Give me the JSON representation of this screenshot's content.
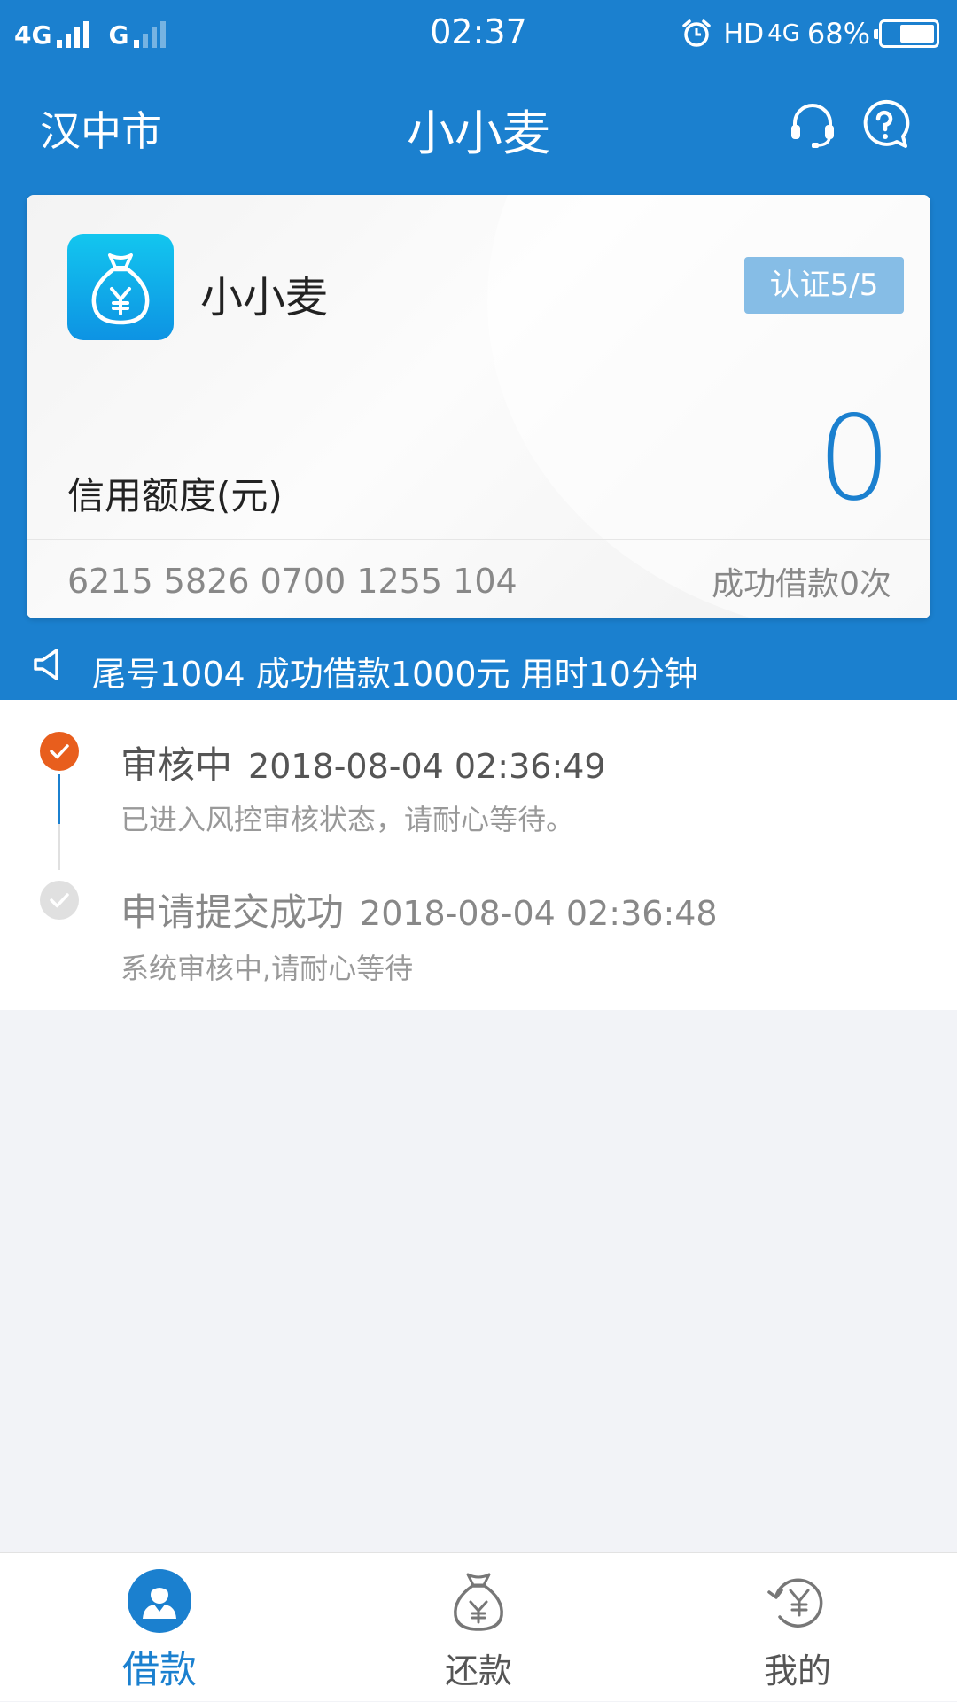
{
  "status_bar": {
    "network_1": "4G",
    "network_2": "G",
    "time": "02:37",
    "hd": "HD",
    "network_3": "4G",
    "battery_percent": "68%",
    "battery_level": 0.68
  },
  "header": {
    "city": "汉中市",
    "title": "小小麦",
    "icons": [
      "headset-icon",
      "help-icon"
    ]
  },
  "card": {
    "app_name": "小小麦",
    "verify_badge": "认证5/5",
    "credit_label": "信用额度(元)",
    "credit_value": "0",
    "card_number": "6215 5826 0700 1255 104",
    "loan_count": "成功借款0次"
  },
  "notice": {
    "text": "尾号1004 成功借款1000元 用时10分钟"
  },
  "timeline": [
    {
      "title": "审核中",
      "time": "2018-08-04 02:36:49",
      "desc": "已进入风控审核状态，请耐心等待。",
      "status": "active"
    },
    {
      "title": "申请提交成功",
      "time": "2018-08-04 02:36:48",
      "desc": "系统审核中,请耐心等待",
      "status": "done"
    }
  ],
  "bottom_nav": [
    {
      "label": "借款",
      "icon": "borrow-icon",
      "active": true
    },
    {
      "label": "还款",
      "icon": "money-bag-icon",
      "active": false
    },
    {
      "label": "我的",
      "icon": "refresh-yen-icon",
      "active": false
    }
  ],
  "colors": {
    "primary": "#1b80cf",
    "accent_orange": "#e85e1d",
    "background": "#f2f3f7"
  }
}
